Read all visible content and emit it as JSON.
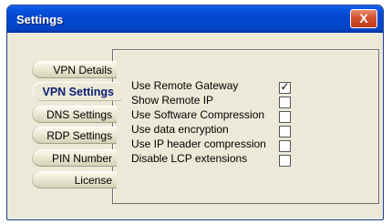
{
  "window": {
    "title": "Settings",
    "close_label": "X"
  },
  "tabs": [
    {
      "label": "VPN Details",
      "active": false
    },
    {
      "label": "VPN Settings",
      "active": true
    },
    {
      "label": "DNS Settings",
      "active": false
    },
    {
      "label": "RDP Settings",
      "active": false
    },
    {
      "label": "PIN Number",
      "active": false
    },
    {
      "label": "License",
      "active": false
    }
  ],
  "options": [
    {
      "label": "Use Remote Gateway",
      "checked": true,
      "mark": "✓"
    },
    {
      "label": "Show Remote IP",
      "checked": false,
      "mark": ""
    },
    {
      "label": "Use Software Compression",
      "checked": false,
      "mark": ""
    },
    {
      "label": "Use data encryption",
      "checked": false,
      "mark": ""
    },
    {
      "label": "Use IP header compression",
      "checked": false,
      "mark": ""
    },
    {
      "label": "Disable LCP extensions",
      "checked": false,
      "mark": ""
    }
  ],
  "colors": {
    "titlebar": "#0548d0",
    "active_tab_text": "#0b1f73",
    "close_button": "#c13a17",
    "panel_background": "#ece9d8"
  }
}
